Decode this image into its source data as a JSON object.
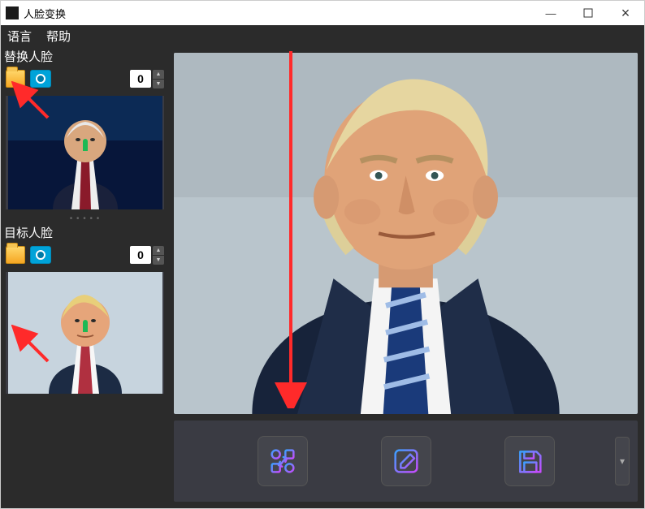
{
  "window": {
    "title": "人脸变换"
  },
  "menu": {
    "language": "语言",
    "help": "帮助"
  },
  "sidebar": {
    "replace": {
      "title": "替换人脸",
      "index": "0"
    },
    "target": {
      "title": "目标人脸",
      "index": "0"
    }
  },
  "icons": {
    "folder": "folder-icon",
    "camera": "camera-icon",
    "swap": "swap-icon",
    "edit": "edit-icon",
    "save": "save-icon",
    "dropdown": "chevron-down-icon"
  },
  "spinner": {
    "up": "▲",
    "down": "▼"
  },
  "win_controls": {
    "min": "—",
    "max": "□",
    "close": "×"
  }
}
